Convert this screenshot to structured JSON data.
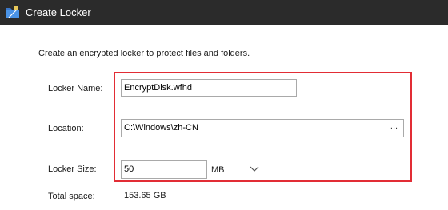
{
  "window": {
    "title": "Create Locker",
    "icon": "locker-app-icon"
  },
  "intro": "Create an encrypted locker to protect files and folders.",
  "form": {
    "name_label": "Locker Name:",
    "name_value": "EncryptDisk.wfhd",
    "location_label": "Location:",
    "location_value": "C:\\Windows\\zh-CN",
    "browse_label": "...",
    "size_label": "Locker Size:",
    "size_value": "50",
    "size_unit": "MB",
    "size_unit_icon": "chevron-down-icon",
    "total_label": "Total space:",
    "total_value": "153.65 GB"
  },
  "colors": {
    "titlebar": "#2b2b2b",
    "highlight": "#e22d35"
  }
}
